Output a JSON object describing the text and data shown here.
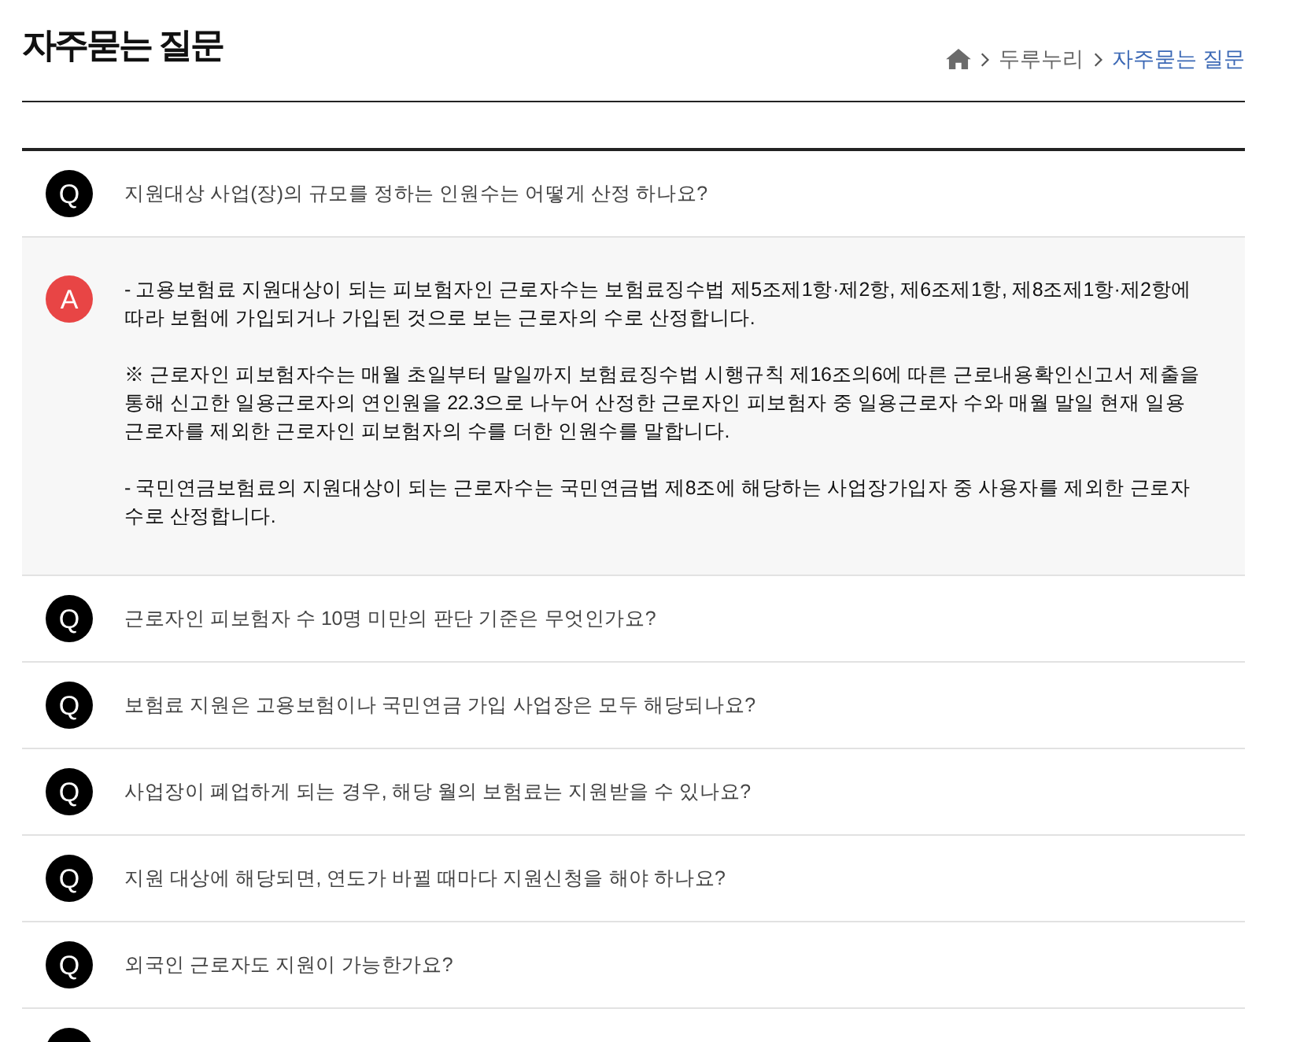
{
  "page": {
    "title": "자주묻는 질문"
  },
  "breadcrumb": [
    {
      "kind": "home"
    },
    {
      "kind": "link",
      "label": "두루누리",
      "selected": false
    },
    {
      "kind": "link",
      "label": "자주묻는 질문",
      "selected": true
    }
  ],
  "faq": [
    {
      "kind": "question",
      "marker": "Q",
      "question": "지원대상 사업(장)의 규모를 정하는 인원수는 어떻게 산정 하나요?",
      "answer": {
        "marker": "A",
        "paragraphs": [
          "- 고용보험료 지원대상이 되는 피보험자인 근로자수는 보험료징수법 제5조제1항·제2항, 제6조제1항, 제8조제1항·제2항에 따라 보험에 가입되거나 가입된 것으로 보는 근로자의 수로 산정합니다.",
          "※ 근로자인 피보험자수는 매월 초일부터 말일까지 보험료징수법 시행규칙 제16조의6에 따른 근로내용확인신고서 제출을 통해 신고한 일용근로자의 연인원을 22.3으로 나누어 산정한 근로자인 피보험자 중 일용근로자 수와 매월 말일 현재 일용근로자를 제외한 근로자인 피보험자의 수를 더한 인원수를 말합니다.",
          "- 국민연금보험료의 지원대상이 되는 근로자수는 국민연금법 제8조에 해당하는 사업장가입자 중 사용자를 제외한 근로자 수로 산정합니다."
        ]
      }
    },
    {
      "kind": "question",
      "marker": "Q",
      "question": "근로자인 피보험자 수 10명 미만의 판단 기준은 무엇인가요?"
    },
    {
      "kind": "question",
      "marker": "Q",
      "question": "보험료 지원은 고용보험이나 국민연금 가입 사업장은 모두 해당되나요?"
    },
    {
      "kind": "question",
      "marker": "Q",
      "question": "사업장이 폐업하게 되는 경우, 해당 월의 보험료는 지원받을 수 있나요?"
    },
    {
      "kind": "question",
      "marker": "Q",
      "question": "지원 대상에 해당되면, 연도가 바뀔 때마다 지원신청을 해야 하나요?"
    },
    {
      "kind": "question",
      "marker": "Q",
      "question": "외국인 근로자도 지원이 가능한가요?"
    },
    {
      "kind": "question"
    }
  ]
}
